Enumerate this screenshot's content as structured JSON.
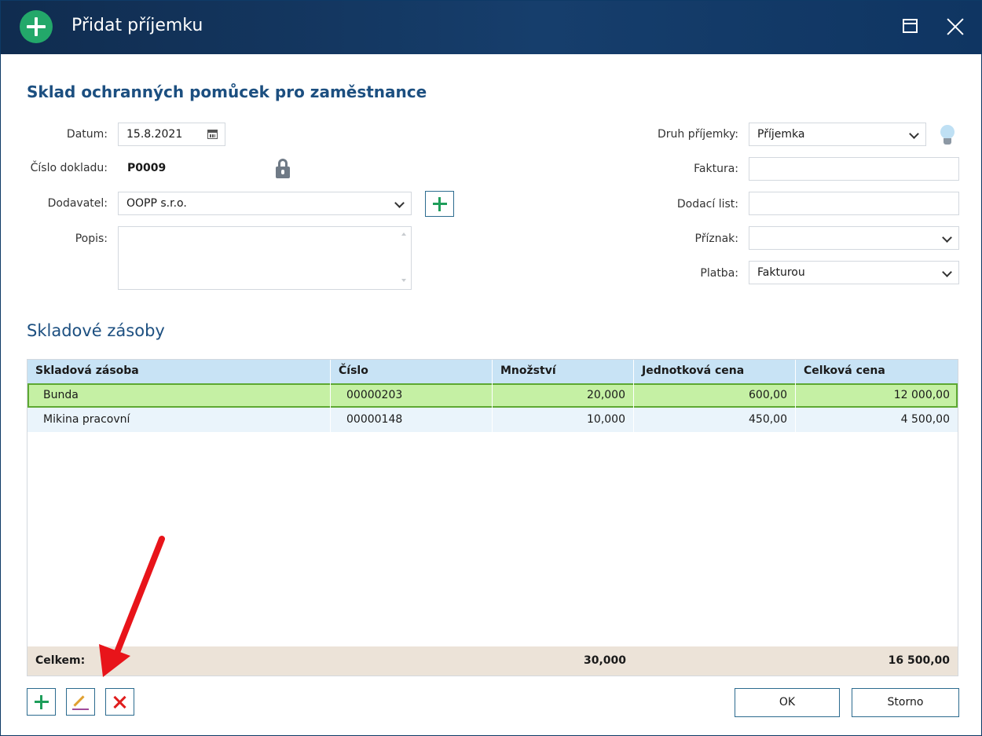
{
  "window": {
    "title": "Přidat příjemku"
  },
  "heading": "Sklad ochranných pomůcek pro zaměstnance",
  "form": {
    "datum_label": "Datum:",
    "datum_value": "15.8.2021",
    "cislo_label": "Číslo dokladu:",
    "cislo_value": "P0009",
    "dodavatel_label": "Dodavatel:",
    "dodavatel_value": "OOPP s.r.o.",
    "popis_label": "Popis:",
    "popis_value": "",
    "druh_label": "Druh příjemky:",
    "druh_value": "Příjemka",
    "faktura_label": "Faktura:",
    "faktura_value": "",
    "dodaci_label": "Dodací list:",
    "dodaci_value": "",
    "priznak_label": "Příznak:",
    "priznak_value": "",
    "platba_label": "Platba:",
    "platba_value": "Fakturou"
  },
  "stock": {
    "title": "Skladové zásoby",
    "columns": [
      "Skladová zásoba",
      "Číslo",
      "Množství",
      "Jednotková cena",
      "Celková cena"
    ],
    "rows": [
      {
        "name": "Bunda",
        "number": "00000203",
        "qty": "20,000",
        "unit_price": "600,00",
        "total": "12 000,00"
      },
      {
        "name": "Mikina pracovní",
        "number": "00000148",
        "qty": "10,000",
        "unit_price": "450,00",
        "total": "4 500,00"
      }
    ],
    "footer": {
      "label": "Celkem:",
      "qty": "30,000",
      "total": "16 500,00"
    }
  },
  "buttons": {
    "ok": "OK",
    "storno": "Storno"
  },
  "icons": {
    "title": "plus-circle-icon",
    "calendar": "calendar-icon",
    "lock": "lock-icon",
    "bulb": "lightbulb-icon",
    "add": "plus-icon",
    "edit": "pencil-icon",
    "delete": "x-icon",
    "annotation": "red-arrow-icon"
  },
  "colors": {
    "titlebar": "#163e6c",
    "accent_green": "#1e9e5a",
    "heading": "#1c4f80",
    "selected_row": "#c5f0a4",
    "header_row": "#c8e3f5",
    "footer_row": "#ece3d8",
    "delete_red": "#e01e1e",
    "annotation_red": "#e8141a"
  }
}
